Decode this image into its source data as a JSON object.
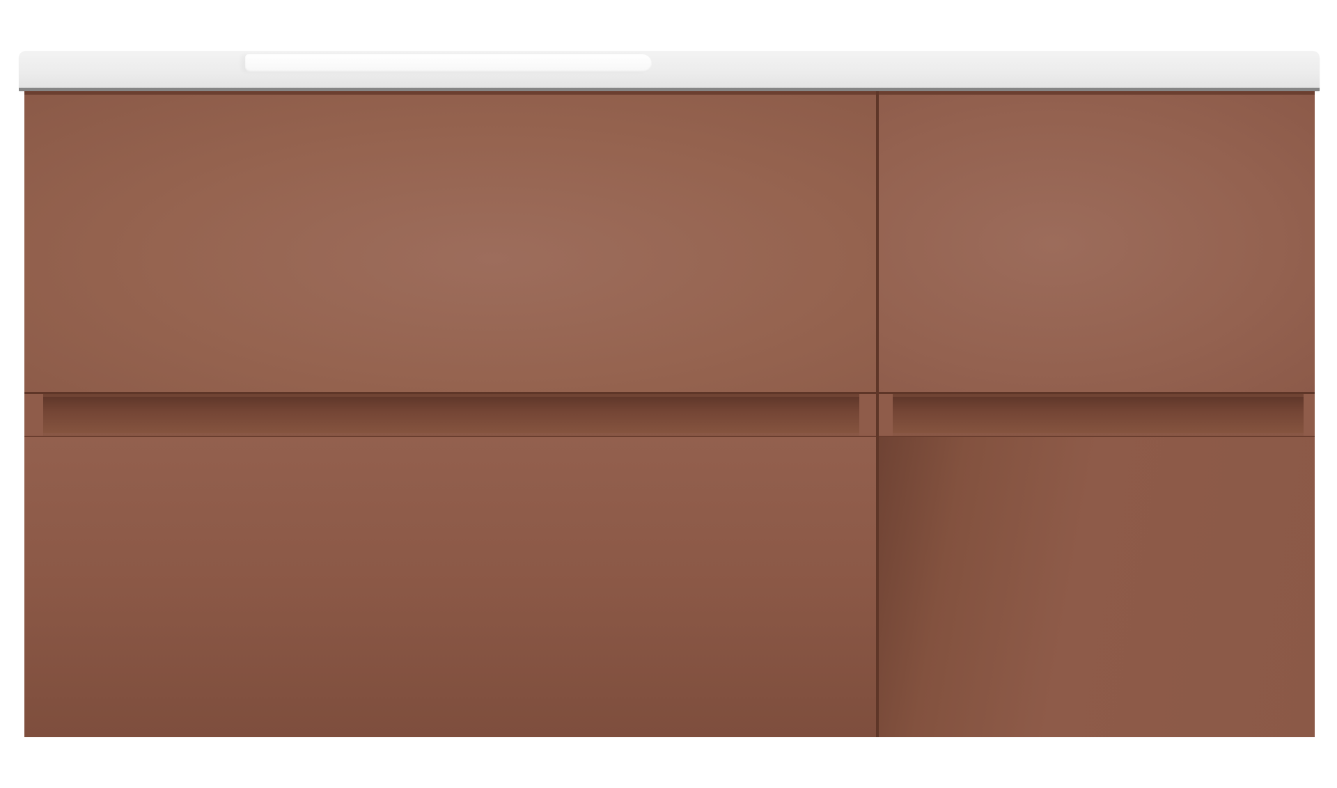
{
  "scene": {
    "subject": "vanity",
    "colors": {
      "cabinet": "#8c5a4a",
      "countertop": "#ececec",
      "background": "#ffffff"
    },
    "drawers": [
      {
        "id": "top-left"
      },
      {
        "id": "top-right"
      },
      {
        "id": "bottom-left"
      },
      {
        "id": "bottom-right"
      }
    ]
  }
}
